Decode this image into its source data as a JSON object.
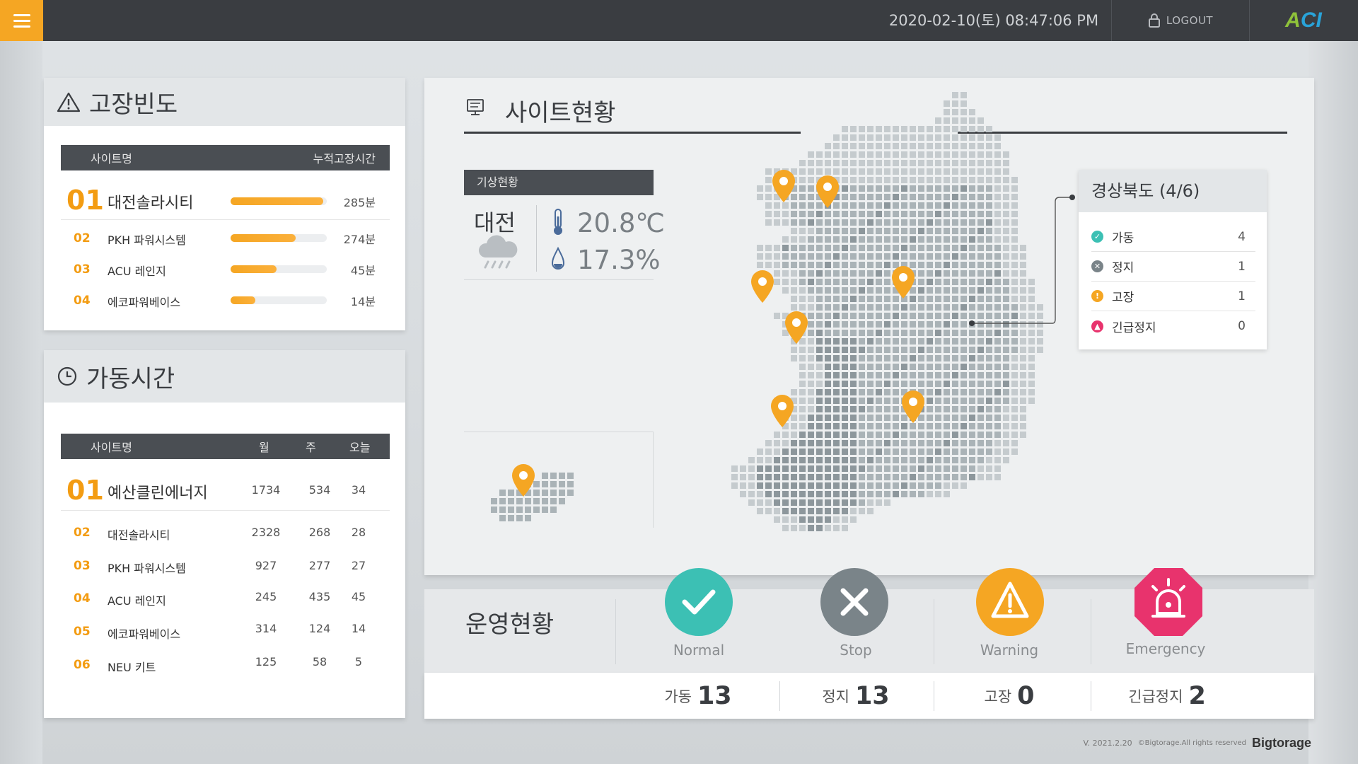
{
  "topbar": {
    "datetime": "2020-02-10(토) 08:47:06 PM",
    "logout_label": "LOGOUT",
    "logo_a": "A",
    "logo_c": "CI",
    "colors": {
      "menu": "#f5a623",
      "bar": "#3a3d41"
    }
  },
  "fault": {
    "title": "고장빈도",
    "col_site": "사이트명",
    "col_time": "누적고장시간",
    "rows": [
      {
        "rank": "01",
        "name": "대전솔라시티",
        "value": "285분",
        "ratio": 0.96
      },
      {
        "rank": "02",
        "name": "PKH 파워시스템",
        "value": "274분",
        "ratio": 0.68
      },
      {
        "rank": "03",
        "name": "ACU 레인지",
        "value": "45분",
        "ratio": 0.48
      },
      {
        "rank": "04",
        "name": "에코파워베이스",
        "value": "14분",
        "ratio": 0.26
      }
    ]
  },
  "runtime": {
    "title": "가동시간",
    "col_site": "사이트명",
    "col_month": "월",
    "col_week": "주",
    "col_today": "오늘",
    "rows": [
      {
        "rank": "01",
        "name": "예산클린에너지",
        "month": "1734",
        "week": "534",
        "today": "34"
      },
      {
        "rank": "02",
        "name": "대전솔라시티",
        "month": "2328",
        "week": "268",
        "today": "28"
      },
      {
        "rank": "03",
        "name": "PKH 파워시스템",
        "month": "927",
        "week": "277",
        "today": "27"
      },
      {
        "rank": "04",
        "name": "ACU 레인지",
        "month": "245",
        "week": "435",
        "today": "45"
      },
      {
        "rank": "05",
        "name": "에코파워베이스",
        "month": "314",
        "week": "124",
        "today": "14"
      },
      {
        "rank": "06",
        "name": "NEU 키트",
        "month": "125",
        "week": "58",
        "today": "5"
      }
    ]
  },
  "site": {
    "title": "사이트현황",
    "weather_label": "기상현황",
    "city": "대전",
    "temperature": "20.8℃",
    "humidity": "17.3%",
    "region": {
      "title": "경상북도 (4/6)",
      "items": [
        {
          "label": "가동",
          "value": "4",
          "color": "#3cc0b4",
          "icon": "check"
        },
        {
          "label": "정지",
          "value": "1",
          "color": "#7a8489",
          "icon": "x"
        },
        {
          "label": "고장",
          "value": "1",
          "color": "#f5a623",
          "icon": "warning"
        },
        {
          "label": "긴급정지",
          "value": "0",
          "color": "#e8336d",
          "icon": "siren"
        }
      ]
    }
  },
  "operation": {
    "title": "운영현황",
    "statuses": [
      {
        "name": "Normal",
        "color": "#3cc0b4"
      },
      {
        "name": "Stop",
        "color": "#7a8489"
      },
      {
        "name": "Warning",
        "color": "#f5a623"
      },
      {
        "name": "Emergency",
        "color": "#e8336d"
      }
    ],
    "counts": [
      {
        "label": "가동",
        "value": "13"
      },
      {
        "label": "정지",
        "value": "13"
      },
      {
        "label": "고장",
        "value": "0"
      },
      {
        "label": "긴급정지",
        "value": "2"
      }
    ]
  },
  "footer": {
    "version": "V. 2021.2.20",
    "copyright": "©Bigtorage.All rights reserved",
    "brand": "Bigtorage"
  }
}
